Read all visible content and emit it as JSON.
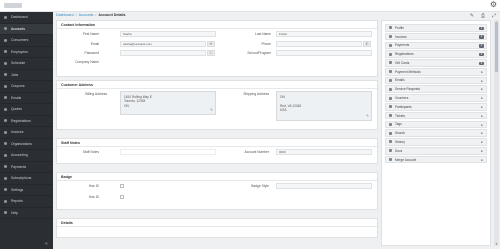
{
  "sidebar": {
    "items": [
      {
        "label": "Dashboard",
        "icon": "dashboard-icon"
      },
      {
        "label": "Accounts",
        "icon": "building-icon"
      },
      {
        "label": "Consumers",
        "icon": "person-icon"
      },
      {
        "label": "Employees",
        "icon": "id-card-icon"
      },
      {
        "label": "Schedule",
        "icon": "calendar-icon"
      },
      {
        "label": "Jobs",
        "icon": "briefcase-icon"
      },
      {
        "label": "Coupons",
        "icon": "tag-icon"
      },
      {
        "label": "Emails",
        "icon": "mail-icon"
      },
      {
        "label": "Quotes",
        "icon": "quote-icon"
      },
      {
        "label": "Registrations",
        "icon": "clipboard-icon"
      },
      {
        "label": "Invoices",
        "icon": "invoice-icon"
      },
      {
        "label": "Organizations",
        "icon": "org-icon"
      },
      {
        "label": "Accounting",
        "icon": "ledger-icon"
      },
      {
        "label": "Payments",
        "icon": "card-icon"
      },
      {
        "label": "Subscriptions",
        "icon": "repeat-icon"
      },
      {
        "label": "Settings",
        "icon": "gear-icon"
      },
      {
        "label": "Reports",
        "icon": "chart-icon"
      },
      {
        "label": "Help",
        "icon": "help-icon"
      }
    ],
    "collapse_glyph": "«"
  },
  "breadcrumb": {
    "first": "Dashboard",
    "second": "Accounts",
    "current": "Account Details",
    "sep": "/"
  },
  "toolbar": {
    "edit_glyph": "✎",
    "print_glyph": "⎙",
    "expand_glyph": "⤢"
  },
  "contact": {
    "title": "Contact Information",
    "first_name_label": "First Name",
    "first_name_value": "Sasha",
    "last_name_label": "Last Name",
    "last_name_value": "Fisher",
    "email_label": "Email",
    "email_value": "sasha@example.com",
    "phone_label": "Phone",
    "password_label": "Password",
    "school_label": "School/Program",
    "company_label": "Company Name"
  },
  "address": {
    "title": "Customer Address",
    "billing_label": "Billing Address",
    "billing_lines": [
      "1810 Rolling Way E",
      "Toronto, 12345",
      "ON"
    ],
    "shipping_label": "Shipping Address",
    "shipping_lines": [
      "ON",
      "",
      "Red, VA 12345",
      "USA"
    ]
  },
  "staff": {
    "title": "Staff Notes",
    "notes_label": "Staff Notes",
    "account_number_label": "Account Number",
    "account_number_value": "0000"
  },
  "badge": {
    "title": "Badge",
    "has_id_label": "Has ID",
    "badge_style_label": "Badge Style",
    "photo_id_label": "Has ID"
  },
  "details": {
    "title": "Details"
  },
  "right_panel": {
    "items": [
      {
        "label": "Profile",
        "count": "1"
      },
      {
        "label": "Invoices",
        "count": "0"
      },
      {
        "label": "Payments",
        "count": "0"
      },
      {
        "label": "Registrations",
        "count": "0"
      },
      {
        "label": "Gift Cards",
        "count": "0"
      },
      {
        "label": "Payment Methods",
        "count": ""
      },
      {
        "label": "Emails",
        "count": ""
      },
      {
        "label": "Service Requests",
        "count": ""
      },
      {
        "label": "Vouchers",
        "count": ""
      },
      {
        "label": "Participants",
        "count": ""
      },
      {
        "label": "Tickets",
        "count": ""
      },
      {
        "label": "Tags",
        "count": ""
      },
      {
        "label": "Search",
        "count": ""
      },
      {
        "label": "History",
        "count": ""
      },
      {
        "label": "Docs",
        "count": ""
      },
      {
        "label": "Merge Account",
        "count": ""
      }
    ]
  },
  "colors": {
    "sidebar_bg": "#2b2f33",
    "link": "#2e8fc2",
    "badge": "#5f6870"
  }
}
